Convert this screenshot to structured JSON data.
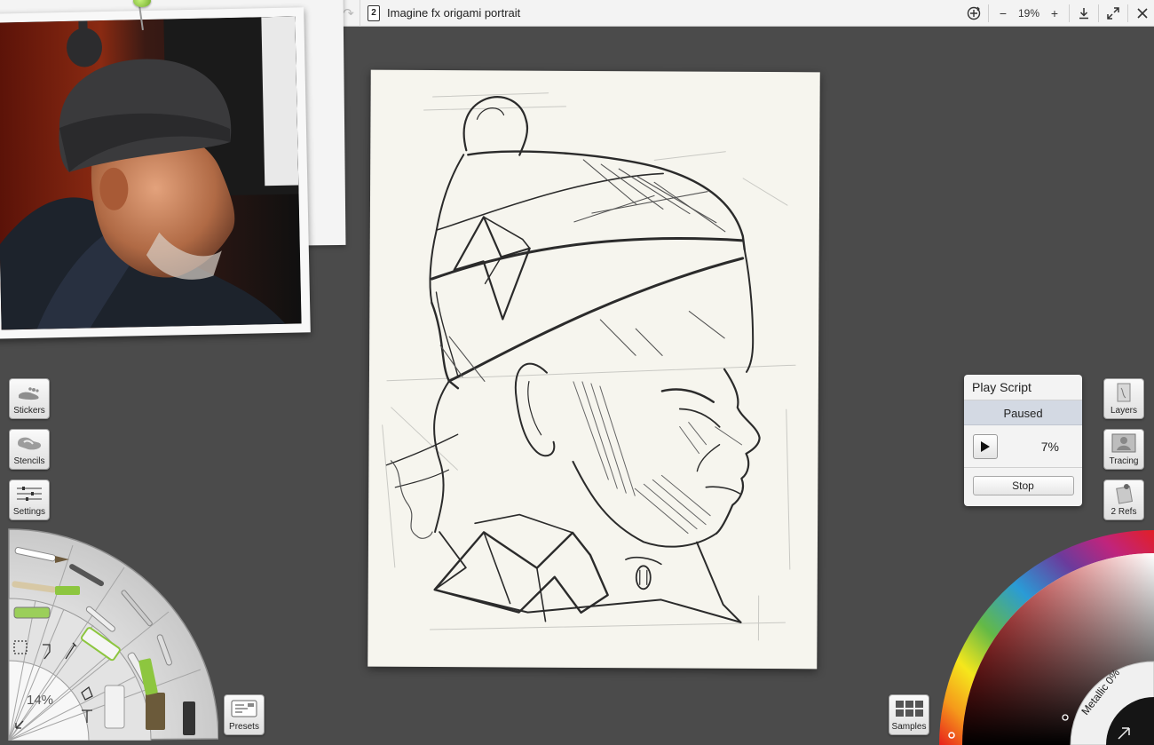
{
  "toolbar": {
    "document_number": "2",
    "document_title": "Imagine fx origami portrait",
    "zoom_out": "−",
    "zoom_level": "19%",
    "zoom_in": "+",
    "icons": [
      "redo-icon",
      "document-icon",
      "transform-icon",
      "download-icon",
      "fullscreen-icon",
      "close-icon"
    ]
  },
  "left_panel": {
    "stickers": "Stickers",
    "stencils": "Stencils",
    "settings": "Settings",
    "presets": "Presets",
    "brush_size": "14%"
  },
  "script_panel": {
    "title": "Play Script",
    "status": "Paused",
    "progress": "7%",
    "stop": "Stop"
  },
  "right_panel": {
    "layers": "Layers",
    "tracing": "Tracing",
    "refs": "2 Refs",
    "samples": "Samples",
    "metallic": "Metallic 0%"
  },
  "colors": {
    "background": "#4b4b4b",
    "toolbar": "#f3f3f3",
    "sheet": "#f6f5ee",
    "accent_green": "#8dc63f",
    "status_blue": "#d3d9e3"
  }
}
